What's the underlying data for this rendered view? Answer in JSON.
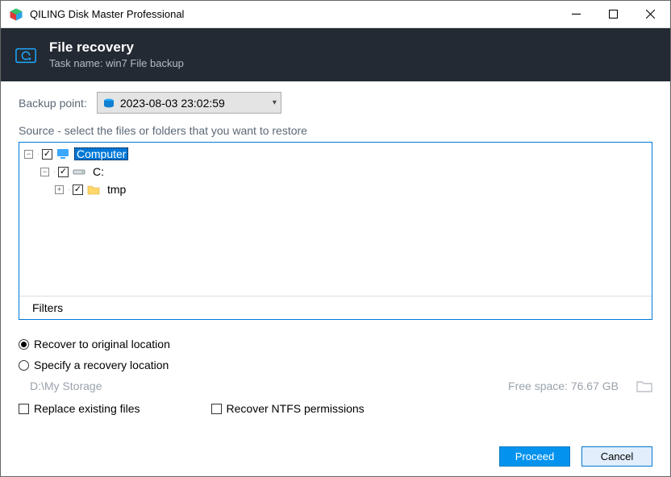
{
  "window": {
    "title": "QILING Disk Master Professional"
  },
  "header": {
    "title": "File recovery",
    "subtitle": "Task name: win7 File backup"
  },
  "backup": {
    "label": "Backup point:",
    "value": "2023-08-03 23:02:59"
  },
  "source": {
    "label": "Source - select the files or folders that you want to restore"
  },
  "tree": {
    "root": "Computer",
    "drive": "C:",
    "folder": "tmp"
  },
  "filters": "Filters",
  "options": {
    "radio1": "Recover to original location",
    "radio2": "Specify a recovery location",
    "path": "D:\\My Storage",
    "free": "Free space: 76.67 GB",
    "check1": "Replace existing files",
    "check2": "Recover NTFS permissions"
  },
  "buttons": {
    "proceed": "Proceed",
    "cancel": "Cancel"
  }
}
